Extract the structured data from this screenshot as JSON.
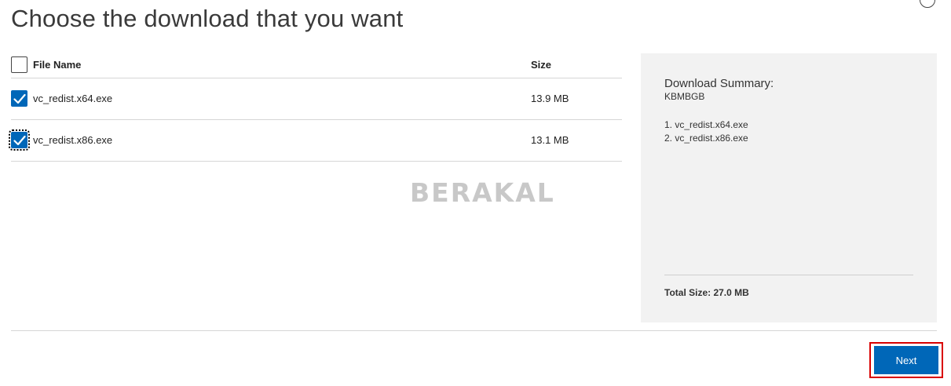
{
  "page": {
    "title": "Choose the download that you want"
  },
  "table": {
    "headers": {
      "name": "File Name",
      "size": "Size"
    },
    "rows": [
      {
        "name": "vc_redist.x64.exe",
        "size": "13.9 MB",
        "checked": true
      },
      {
        "name": "vc_redist.x86.exe",
        "size": "13.1 MB",
        "checked": true
      }
    ]
  },
  "watermark": "BERAKAL",
  "summary": {
    "title": "Download Summary:",
    "kb": "KBMBGB",
    "items": [
      "1. vc_redist.x64.exe",
      "2. vc_redist.x86.exe"
    ],
    "total": "Total Size: 27.0 MB"
  },
  "actions": {
    "next_label": "Next"
  },
  "colors": {
    "accent": "#0067b8",
    "highlight": "#d90000",
    "panel": "#f2f2f2"
  }
}
